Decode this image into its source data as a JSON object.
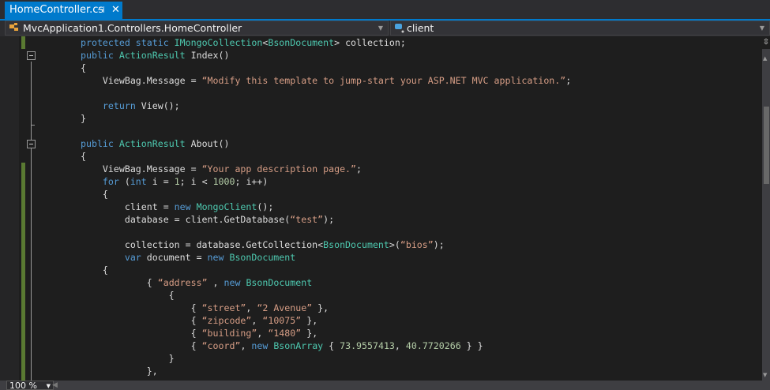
{
  "tab": {
    "title": "HomeController.cs",
    "pin_icon": "⊣",
    "close_icon": "✕"
  },
  "navbar": {
    "class_path": "MvcApplication1.Controllers.HomeController",
    "member": "client"
  },
  "zoom": {
    "level": "100 %"
  },
  "colors": {
    "keyword": "#569cd6",
    "type": "#4ec9b0",
    "string": "#d69d85",
    "number": "#b5cea8",
    "accent": "#007acc"
  },
  "code": [
    [
      [
        "kw",
        "protected static "
      ],
      [
        "ty",
        "IMongoCollection"
      ],
      [
        "pl",
        "<"
      ],
      [
        "ty",
        "BsonDocument"
      ],
      [
        "pl",
        "> collection;"
      ]
    ],
    [
      [
        "kw",
        "public "
      ],
      [
        "ty",
        "ActionResult"
      ],
      [
        "pl",
        " Index()"
      ]
    ],
    [
      [
        "pl",
        "{"
      ]
    ],
    [
      [
        "pl",
        "    ViewBag.Message = "
      ],
      [
        "st",
        "“Modify this template to jump-start your ASP.NET MVC application.”"
      ],
      [
        "pl",
        ";"
      ]
    ],
    [],
    [
      [
        "kw",
        "    return "
      ],
      [
        "pl",
        "View();"
      ]
    ],
    [
      [
        "pl",
        "}"
      ]
    ],
    [],
    [
      [
        "kw",
        "public "
      ],
      [
        "ty",
        "ActionResult"
      ],
      [
        "pl",
        " About()"
      ]
    ],
    [
      [
        "pl",
        "{"
      ]
    ],
    [
      [
        "pl",
        "    ViewBag.Message = "
      ],
      [
        "st",
        "“Your app description page.”"
      ],
      [
        "pl",
        ";"
      ]
    ],
    [
      [
        "kw",
        "    for "
      ],
      [
        "pl",
        "("
      ],
      [
        "kw",
        "int"
      ],
      [
        "pl",
        " i = "
      ],
      [
        "nu",
        "1"
      ],
      [
        "pl",
        "; i < "
      ],
      [
        "nu",
        "1000"
      ],
      [
        "pl",
        "; i++)"
      ]
    ],
    [
      [
        "pl",
        "    {"
      ]
    ],
    [
      [
        "pl",
        "        client = "
      ],
      [
        "kw",
        "new "
      ],
      [
        "ty",
        "MongoClient"
      ],
      [
        "pl",
        "();"
      ]
    ],
    [
      [
        "pl",
        "        database = client.GetDatabase("
      ],
      [
        "st",
        "“test”"
      ],
      [
        "pl",
        ");"
      ]
    ],
    [],
    [
      [
        "pl",
        "        collection = database.GetCollection<"
      ],
      [
        "ty",
        "BsonDocument"
      ],
      [
        "pl",
        ">("
      ],
      [
        "st",
        "“bios”"
      ],
      [
        "pl",
        ");"
      ]
    ],
    [
      [
        "kw",
        "        var "
      ],
      [
        "pl",
        "document = "
      ],
      [
        "kw",
        "new "
      ],
      [
        "ty",
        "BsonDocument"
      ]
    ],
    [
      [
        "pl",
        "    {"
      ]
    ],
    [
      [
        "pl",
        "            { "
      ],
      [
        "st",
        "“address”"
      ],
      [
        "pl",
        " , "
      ],
      [
        "kw",
        "new "
      ],
      [
        "ty",
        "BsonDocument"
      ]
    ],
    [
      [
        "pl",
        "                {"
      ]
    ],
    [
      [
        "pl",
        "                    { "
      ],
      [
        "st",
        "“street”"
      ],
      [
        "pl",
        ", "
      ],
      [
        "st",
        "“2 Avenue”"
      ],
      [
        "pl",
        " },"
      ]
    ],
    [
      [
        "pl",
        "                    { "
      ],
      [
        "st",
        "“zipcode”"
      ],
      [
        "pl",
        ", "
      ],
      [
        "st",
        "“10075”"
      ],
      [
        "pl",
        " },"
      ]
    ],
    [
      [
        "pl",
        "                    { "
      ],
      [
        "st",
        "“building”"
      ],
      [
        "pl",
        ", "
      ],
      [
        "st",
        "“1480”"
      ],
      [
        "pl",
        " },"
      ]
    ],
    [
      [
        "pl",
        "                    { "
      ],
      [
        "st",
        "“coord”"
      ],
      [
        "pl",
        ", "
      ],
      [
        "kw",
        "new "
      ],
      [
        "ty",
        "BsonArray"
      ],
      [
        "pl",
        " { "
      ],
      [
        "nu",
        "73.9557413"
      ],
      [
        "pl",
        ", "
      ],
      [
        "nu",
        "40.7720266"
      ],
      [
        "pl",
        " } }"
      ]
    ],
    [
      [
        "pl",
        "                }"
      ]
    ],
    [
      [
        "pl",
        "            },"
      ]
    ]
  ]
}
